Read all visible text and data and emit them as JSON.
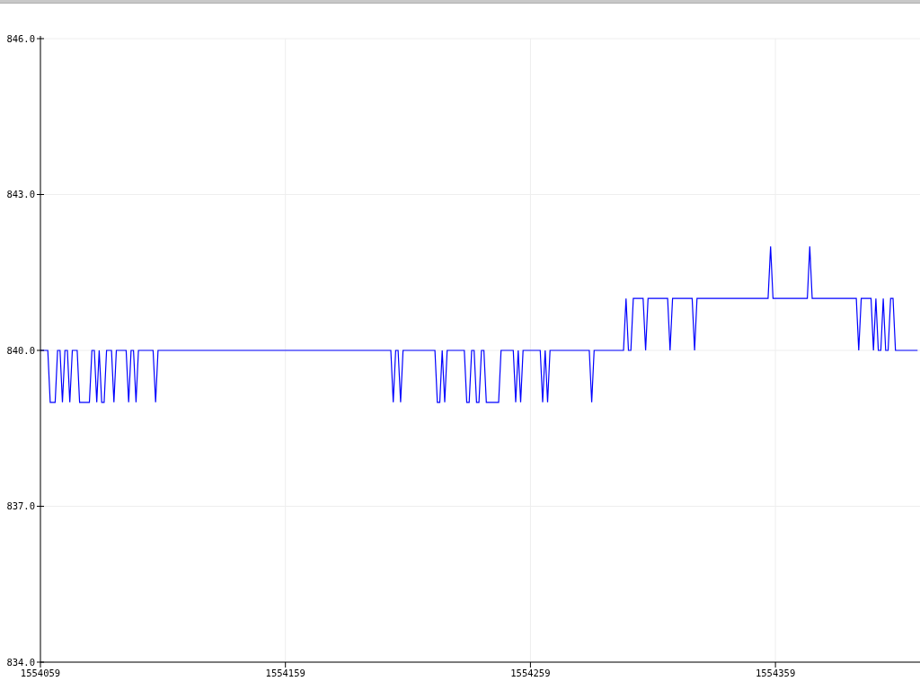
{
  "chart_data": {
    "type": "line",
    "grid": true,
    "x": [
      1554059,
      1554062,
      1554063,
      1554065,
      1554066,
      1554067,
      1554068,
      1554069,
      1554070,
      1554071,
      1554072,
      1554074,
      1554075,
      1554079,
      1554080,
      1554081,
      1554082,
      1554083,
      1554084,
      1554085,
      1554086,
      1554088,
      1554089,
      1554090,
      1554094,
      1554095,
      1554096,
      1554097,
      1554098,
      1554099,
      1554105,
      1554106,
      1554107,
      1554202,
      1554203,
      1554204,
      1554205,
      1554206,
      1554207,
      1554220,
      1554221,
      1554222,
      1554223,
      1554224,
      1554225,
      1554232,
      1554233,
      1554234,
      1554235,
      1554236,
      1554237,
      1554238,
      1554239,
      1554240,
      1554241,
      1554246,
      1554247,
      1554252,
      1554253,
      1554254,
      1554255,
      1554256,
      1554263,
      1554264,
      1554265,
      1554266,
      1554267,
      1554283,
      1554284,
      1554285,
      1554297,
      1554298,
      1554299,
      1554300,
      1554301,
      1554305,
      1554306,
      1554307,
      1554315,
      1554316,
      1554317,
      1554325,
      1554326,
      1554327,
      1554356,
      1554357,
      1554358,
      1554372,
      1554373,
      1554374,
      1554392,
      1554393,
      1554394,
      1554398,
      1554399,
      1554400,
      1554401,
      1554402,
      1554403,
      1554404,
      1554405,
      1554406,
      1554407,
      1554408,
      1554417
    ],
    "series": [
      {
        "color": "#0000ff",
        "values": [
          840,
          840,
          839,
          839,
          840,
          840,
          839,
          840,
          840,
          839,
          840,
          840,
          839,
          839,
          840,
          840,
          839,
          840,
          839,
          839,
          840,
          840,
          839,
          840,
          840,
          839,
          840,
          840,
          839,
          840,
          840,
          839,
          840,
          840,
          839,
          840,
          840,
          839,
          840,
          840,
          839,
          839,
          840,
          839,
          840,
          840,
          839,
          839,
          840,
          840,
          839,
          839,
          840,
          840,
          839,
          839,
          840,
          840,
          839,
          840,
          839,
          840,
          840,
          839,
          840,
          839,
          840,
          840,
          839,
          840,
          840,
          841,
          840,
          840,
          841,
          841,
          840,
          841,
          841,
          840,
          841,
          841,
          840,
          841,
          841,
          842,
          841,
          841,
          842,
          841,
          841,
          840,
          841,
          841,
          840,
          841,
          840,
          840,
          841,
          840,
          840,
          841,
          841,
          840,
          840
        ]
      }
    ],
    "xlim": [
      1554059,
      1554418
    ],
    "ylim": [
      834,
      846
    ],
    "xticks": [
      1554059,
      1554159,
      1554259,
      1554359
    ],
    "yticks": [
      {
        "value": 834,
        "label": "834.0"
      },
      {
        "value": 837,
        "label": "837.0"
      },
      {
        "value": 840,
        "label": "840.0"
      },
      {
        "value": 843,
        "label": "843.0"
      },
      {
        "value": 846,
        "label": "846.0"
      }
    ]
  }
}
